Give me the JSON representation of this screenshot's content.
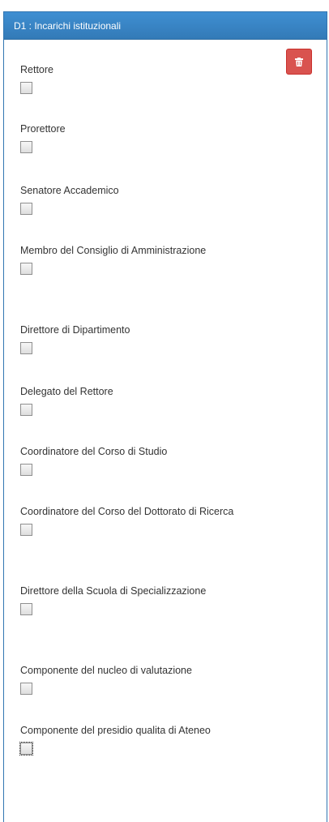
{
  "panel": {
    "title": "D1 : Incarichi istituzionali",
    "delete_icon": "trash-icon",
    "colors": {
      "heading": "#337ab7",
      "delete_button": "#d9534f"
    }
  },
  "fields": [
    {
      "label": "Rettore",
      "checked": false
    },
    {
      "label": "Prorettore",
      "checked": false
    },
    {
      "label": "Senatore Accademico",
      "checked": false
    },
    {
      "label": "Membro del Consiglio di Amministrazione",
      "checked": false
    },
    {
      "label": "Direttore di Dipartimento",
      "checked": false
    },
    {
      "label": "Delegato del Rettore",
      "checked": false
    },
    {
      "label": "Coordinatore del Corso di Studio",
      "checked": false
    },
    {
      "label": "Coordinatore del Corso del Dottorato di Ricerca",
      "checked": false
    },
    {
      "label": "Direttore della Scuola di Specializzazione",
      "checked": false
    },
    {
      "label": "Componente del nucleo di valutazione",
      "checked": false
    },
    {
      "label": "Componente del presidio qualita di Ateneo",
      "checked": false
    }
  ]
}
